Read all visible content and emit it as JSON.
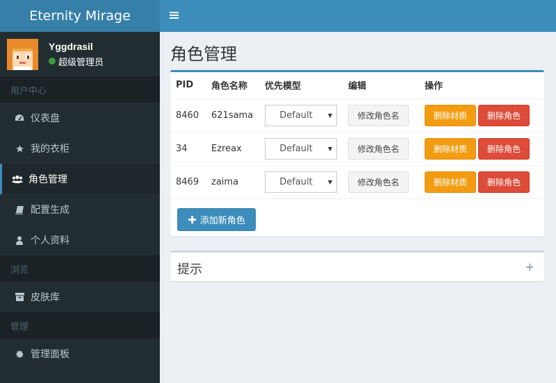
{
  "app": {
    "logo": "Eternity Mirage"
  },
  "user": {
    "name": "Yggdrasil",
    "role": "超级管理员"
  },
  "sidebar": {
    "sections": [
      {
        "header": "用户中心",
        "items": [
          {
            "label": "仪表盘",
            "icon": "dashboard-icon"
          },
          {
            "label": "我的衣柜",
            "icon": "star-icon"
          },
          {
            "label": "角色管理",
            "icon": "users-icon",
            "active": true
          },
          {
            "label": "配置生成",
            "icon": "book-icon"
          },
          {
            "label": "个人资料",
            "icon": "user-icon"
          }
        ]
      },
      {
        "header": "浏览",
        "items": [
          {
            "label": "皮肤库",
            "icon": "archive-icon"
          }
        ]
      },
      {
        "header": "管理",
        "items": [
          {
            "label": "管理面板",
            "icon": "gear-icon"
          }
        ]
      }
    ]
  },
  "page": {
    "title": "角色管理"
  },
  "table": {
    "headers": [
      "PID",
      "角色名称",
      "优先模型",
      "编辑",
      "操作"
    ],
    "rows": [
      {
        "pid": "8460",
        "name": "621sama",
        "model": "Default"
      },
      {
        "pid": "34",
        "name": "Ezreax",
        "model": "Default"
      },
      {
        "pid": "8469",
        "name": "zaima",
        "model": "Default"
      }
    ],
    "rename_label": "修改角色名",
    "delete_texture_label": "删除材质",
    "delete_player_label": "删除角色"
  },
  "add_button": "添加新角色",
  "tips": {
    "title": "提示"
  },
  "colors": {
    "accent": "#3c8dbc",
    "warning": "#f39c12",
    "danger": "#dd4b39",
    "sidebar": "#222d32"
  }
}
